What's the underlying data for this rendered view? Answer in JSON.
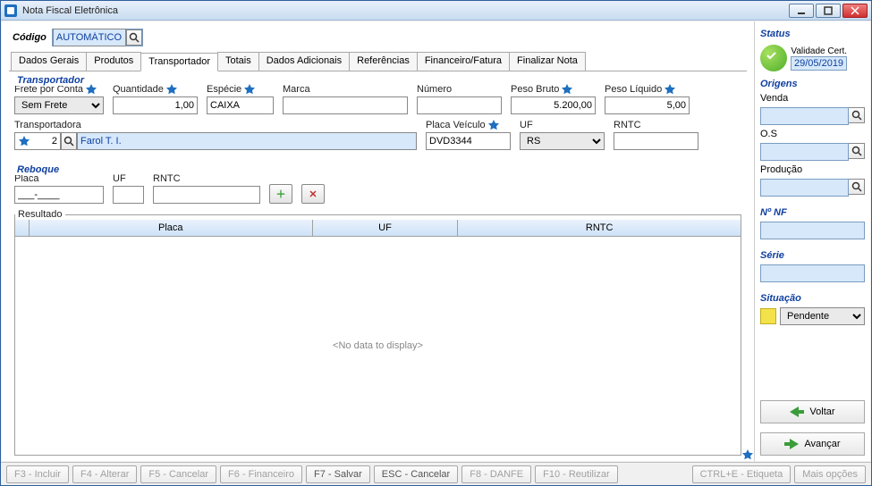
{
  "window": {
    "title": "Nota Fiscal Eletrônica"
  },
  "codigo": {
    "label": "Código",
    "value": "AUTOMÁTICO"
  },
  "tabs": {
    "items": [
      {
        "label": "Dados Gerais"
      },
      {
        "label": "Produtos"
      },
      {
        "label": "Transportador"
      },
      {
        "label": "Totais"
      },
      {
        "label": "Dados Adicionais"
      },
      {
        "label": "Referências"
      },
      {
        "label": "Financeiro/Fatura"
      },
      {
        "label": "Finalizar Nota"
      }
    ],
    "active": 2
  },
  "transportador": {
    "title": "Transportador",
    "frete_label": "Frete por Conta",
    "frete_value": "Sem Frete",
    "quantidade_label": "Quantidade",
    "quantidade_value": "1,00",
    "especie_label": "Espécie",
    "especie_value": "CAIXA",
    "marca_label": "Marca",
    "marca_value": "",
    "numero_label": "Número",
    "numero_value": "",
    "peso_bruto_label": "Peso Bruto",
    "peso_bruto_value": "5.200,00",
    "peso_liquido_label": "Peso Líquido",
    "peso_liquido_value": "5,00",
    "transportadora_label": "Transportadora",
    "transportadora_code": "2",
    "transportadora_nome": "Farol T. I.",
    "placa_veiculo_label": "Placa Veículo",
    "placa_veiculo_value": "DVD3344",
    "uf_label": "UF",
    "uf_value": "RS",
    "rntc_label": "RNTC",
    "rntc_value": ""
  },
  "reboque": {
    "title": "Reboque",
    "placa_label": "Placa",
    "placa_value": "___-____",
    "uf_label": "UF",
    "uf_value": "",
    "rntc_label": "RNTC",
    "rntc_value": "",
    "resultado_label": "Resultado",
    "col_placa": "Placa",
    "col_uf": "UF",
    "col_rntc": "RNTC",
    "empty": "<No data to display>"
  },
  "side": {
    "status_title": "Status",
    "validade_label": "Validade Cert.",
    "validade_value": "29/05/2019",
    "origens_title": "Origens",
    "venda_label": "Venda",
    "os_label": "O.S",
    "producao_label": "Produção",
    "nf_title": "Nº NF",
    "serie_title": "Série",
    "situacao_title": "Situação",
    "situacao_value": "Pendente",
    "voltar_label": "Voltar",
    "avancar_label": "Avançar"
  },
  "bottom": {
    "f3": "F3 - Incluir",
    "f4": "F4 - Alterar",
    "f5": "F5 - Cancelar",
    "f6": "F6 - Financeiro",
    "f7": "F7 - Salvar",
    "esc": "ESC - Cancelar",
    "f8": "F8 - DANFE",
    "f10": "F10 - Reutilizar",
    "etiqueta": "CTRL+E - Etiqueta",
    "mais": "Mais opções"
  },
  "icons": {
    "star": "star-icon",
    "search": "search-icon",
    "plus": "plus-icon",
    "times": "times-icon",
    "check": "check-icon",
    "arrow_left": "arrow-left-icon",
    "arrow_right": "arrow-right-icon"
  }
}
